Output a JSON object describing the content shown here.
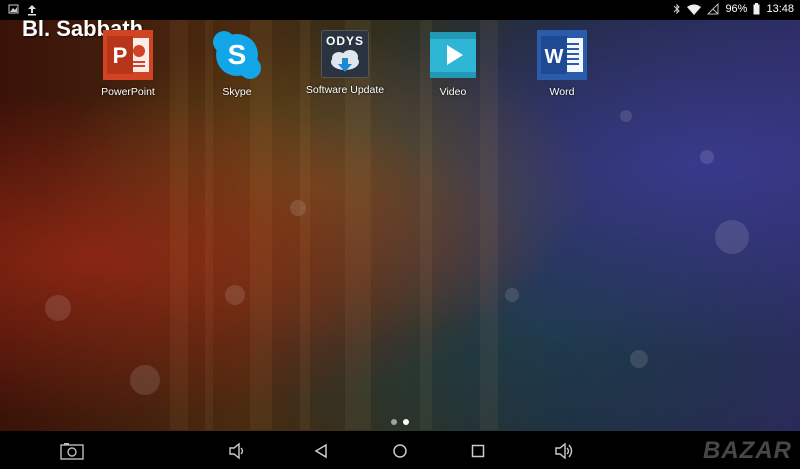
{
  "status_bar": {
    "battery": "96%",
    "time": "13:48",
    "left_icons": [
      "image-notification-icon",
      "upload-icon"
    ],
    "right_icons": [
      "bluetooth-icon",
      "wifi-icon",
      "no-sim-icon",
      "battery-icon"
    ]
  },
  "overlay": {
    "carrier_text": "Bl. Sabbath"
  },
  "apps": [
    {
      "label": "PowerPoint",
      "icon": "powerpoint-icon"
    },
    {
      "label": "Skype",
      "icon": "skype-icon"
    },
    {
      "label": "Software Update",
      "icon": "software-update-icon",
      "icon_text": "ODYS"
    },
    {
      "label": "Video",
      "icon": "video-icon"
    },
    {
      "label": "Word",
      "icon": "word-icon"
    }
  ],
  "pager": {
    "pages": 2,
    "current_page": 2
  },
  "nav_bar": {
    "buttons": [
      "screenshot-icon",
      "volume-down-icon",
      "back-icon",
      "home-icon",
      "recents-icon",
      "volume-up-icon"
    ]
  },
  "watermark": "BAZAR"
}
